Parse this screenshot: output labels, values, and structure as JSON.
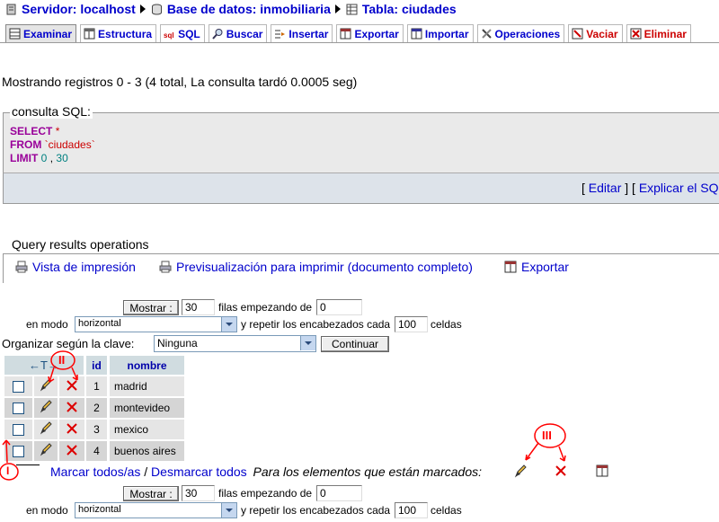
{
  "breadcrumb": {
    "server": "Servidor: localhost",
    "database": "Base de datos: inmobiliaria",
    "table": "Tabla: ciudades"
  },
  "tabs": [
    {
      "label": "Examinar",
      "icon": "browse-icon"
    },
    {
      "label": "Estructura",
      "icon": "structure-icon"
    },
    {
      "label": "SQL",
      "icon": "sql-icon"
    },
    {
      "label": "Buscar",
      "icon": "search-icon"
    },
    {
      "label": "Insertar",
      "icon": "insert-icon"
    },
    {
      "label": "Exportar",
      "icon": "export-icon"
    },
    {
      "label": "Importar",
      "icon": "import-icon"
    },
    {
      "label": "Operaciones",
      "icon": "operations-icon"
    },
    {
      "label": "Vaciar",
      "icon": "empty-icon"
    },
    {
      "label": "Eliminar",
      "icon": "drop-icon"
    }
  ],
  "status": "Mostrando registros 0 - 3 (4 total, La consulta tardó 0.0005 seg)",
  "sql": {
    "legend": "consulta SQL:",
    "select_kw": "SELECT",
    "star": "*",
    "from_kw": "FROM",
    "table": "`ciudades`",
    "limit_kw": "LIMIT",
    "limit_a": "0",
    "limit_sep": ",",
    "limit_b": "30",
    "edit_link": "Editar",
    "explain_link": "Explicar el SQL"
  },
  "ops": {
    "legend": "Query results operations",
    "print_view": "Vista de impresión",
    "print_full": "Previsualización para imprimir (documento completo)",
    "export": "Exportar"
  },
  "nav_top": {
    "show_button": "Mostrar :",
    "rows_value": "30",
    "rows_label": "filas empezando de",
    "start_value": "0",
    "mode_label": "en modo",
    "mode_value": "horizontal",
    "repeat_label": "y repetir los encabezados cada",
    "repeat_value": "100",
    "cells_label": "celdas"
  },
  "sort": {
    "label": "Organizar según la clave:",
    "value": "Ninguna",
    "button": "Continuar"
  },
  "table": {
    "arrows": "←T→",
    "columns": [
      "id",
      "nombre"
    ],
    "rows": [
      {
        "id": "1",
        "nombre": "madrid"
      },
      {
        "id": "2",
        "nombre": "montevideo"
      },
      {
        "id": "3",
        "nombre": "mexico"
      },
      {
        "id": "4",
        "nombre": "buenos aires"
      }
    ]
  },
  "bulk": {
    "check_all": "Marcar todos/as",
    "slash": "/",
    "uncheck_all": "Desmarcar todos",
    "with_selected": "Para los elementos que están marcados:"
  },
  "nav_bottom": {
    "show_button": "Mostrar :",
    "rows_value": "30",
    "rows_label": "filas empezando de",
    "start_value": "0",
    "mode_label": "en modo",
    "mode_value": "horizontal",
    "repeat_label": "y repetir los encabezados cada",
    "repeat_value": "100",
    "cells_label": "celdas"
  },
  "annotations": {
    "mark1": "I",
    "mark2": "II",
    "mark3": "III"
  },
  "colors": {
    "link": "#0000cc",
    "header_bg": "#d0dce0",
    "row_bg": "#e5e5e5",
    "annotation": "#ff0000"
  }
}
